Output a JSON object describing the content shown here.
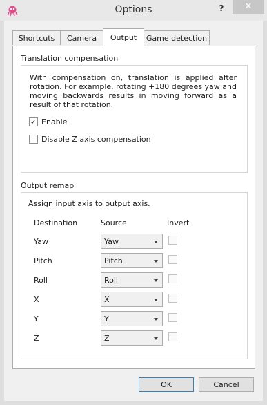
{
  "window": {
    "title": "Options",
    "help_label": "?",
    "close_label": "✕"
  },
  "tabs": [
    {
      "label": "Shortcuts"
    },
    {
      "label": "Camera"
    },
    {
      "label": "Output"
    },
    {
      "label": "Game detection"
    }
  ],
  "active_tab": "Output",
  "translation": {
    "title": "Translation compensation",
    "description": "With compensation on, translation is applied after rotation. For example, rotating +180 degrees yaw and moving backwards results in moving forward as a result of that rotation.",
    "enable": {
      "label": "Enable",
      "checked": true,
      "mark": "✓"
    },
    "disable_z": {
      "label": "Disable Z axis compensation",
      "checked": false
    }
  },
  "remap": {
    "title": "Output remap",
    "instruction": "Assign input axis to output axis.",
    "headers": {
      "destination": "Destination",
      "source": "Source",
      "invert": "Invert"
    },
    "rows": [
      {
        "destination": "Yaw",
        "source": "Yaw",
        "invert": false
      },
      {
        "destination": "Pitch",
        "source": "Pitch",
        "invert": false
      },
      {
        "destination": "Roll",
        "source": "Roll",
        "invert": false
      },
      {
        "destination": "X",
        "source": "X",
        "invert": false
      },
      {
        "destination": "Y",
        "source": "Y",
        "invert": false
      },
      {
        "destination": "Z",
        "source": "Z",
        "invert": false
      }
    ]
  },
  "buttons": {
    "ok": "OK",
    "cancel": "Cancel"
  },
  "colors": {
    "window_bg": "#dedede",
    "client_bg": "#f0f0f0",
    "pane_bg": "#ffffff",
    "default_border": "#3c7fb1",
    "icon_pink": "#e0508c"
  }
}
